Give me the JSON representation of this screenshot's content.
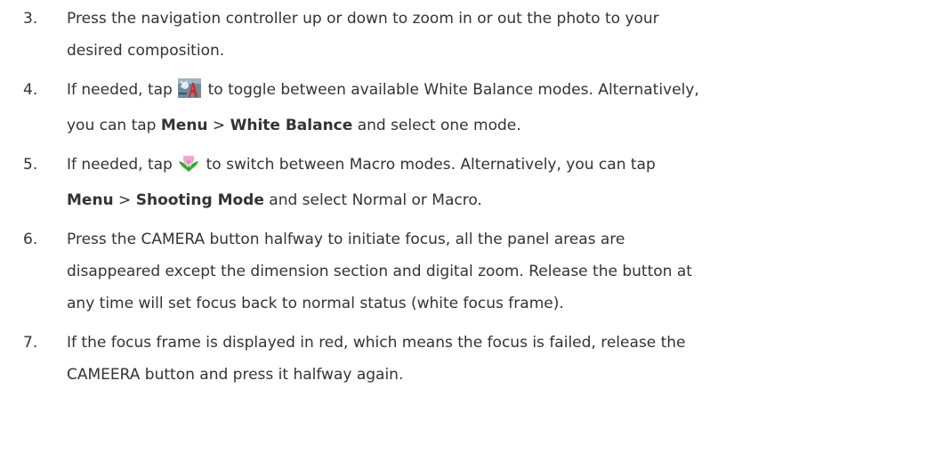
{
  "steps": [
    {
      "number": "3.",
      "line1": "Press the navigation controller up or down to zoom in or out the photo to your",
      "line2": "desired composition."
    },
    {
      "number": "4.",
      "line1_pre": "If needed, tap ",
      "icon": "white-balance-icon",
      "line1_post": " to toggle between available White Balance modes. Alternatively,",
      "line2_pre": "you can tap ",
      "bold1": "Menu",
      "sep": " > ",
      "bold2": "White Balance",
      "line2_post": " and select one mode."
    },
    {
      "number": "5.",
      "line1_pre": "If needed, tap ",
      "icon": "macro-flower-icon",
      "line1_post": " to switch between Macro modes. Alternatively, you can tap",
      "bold1": "Menu",
      "sep": " > ",
      "bold2": "Shooting Mode",
      "line2_post": " and select Normal or Macro."
    },
    {
      "number": "6.",
      "line1": "Press the CAMERA button halfway to initiate focus, all the panel areas are",
      "line2": "disappeared except the dimension section and digital zoom. Release the button at",
      "line3": "any time will set focus back to normal status (white focus frame)."
    },
    {
      "number": "7.",
      "line1": "If the focus frame is displayed in red, which means the focus is failed, release the",
      "line2": "CAMEERA button and press it halfway again."
    }
  ]
}
